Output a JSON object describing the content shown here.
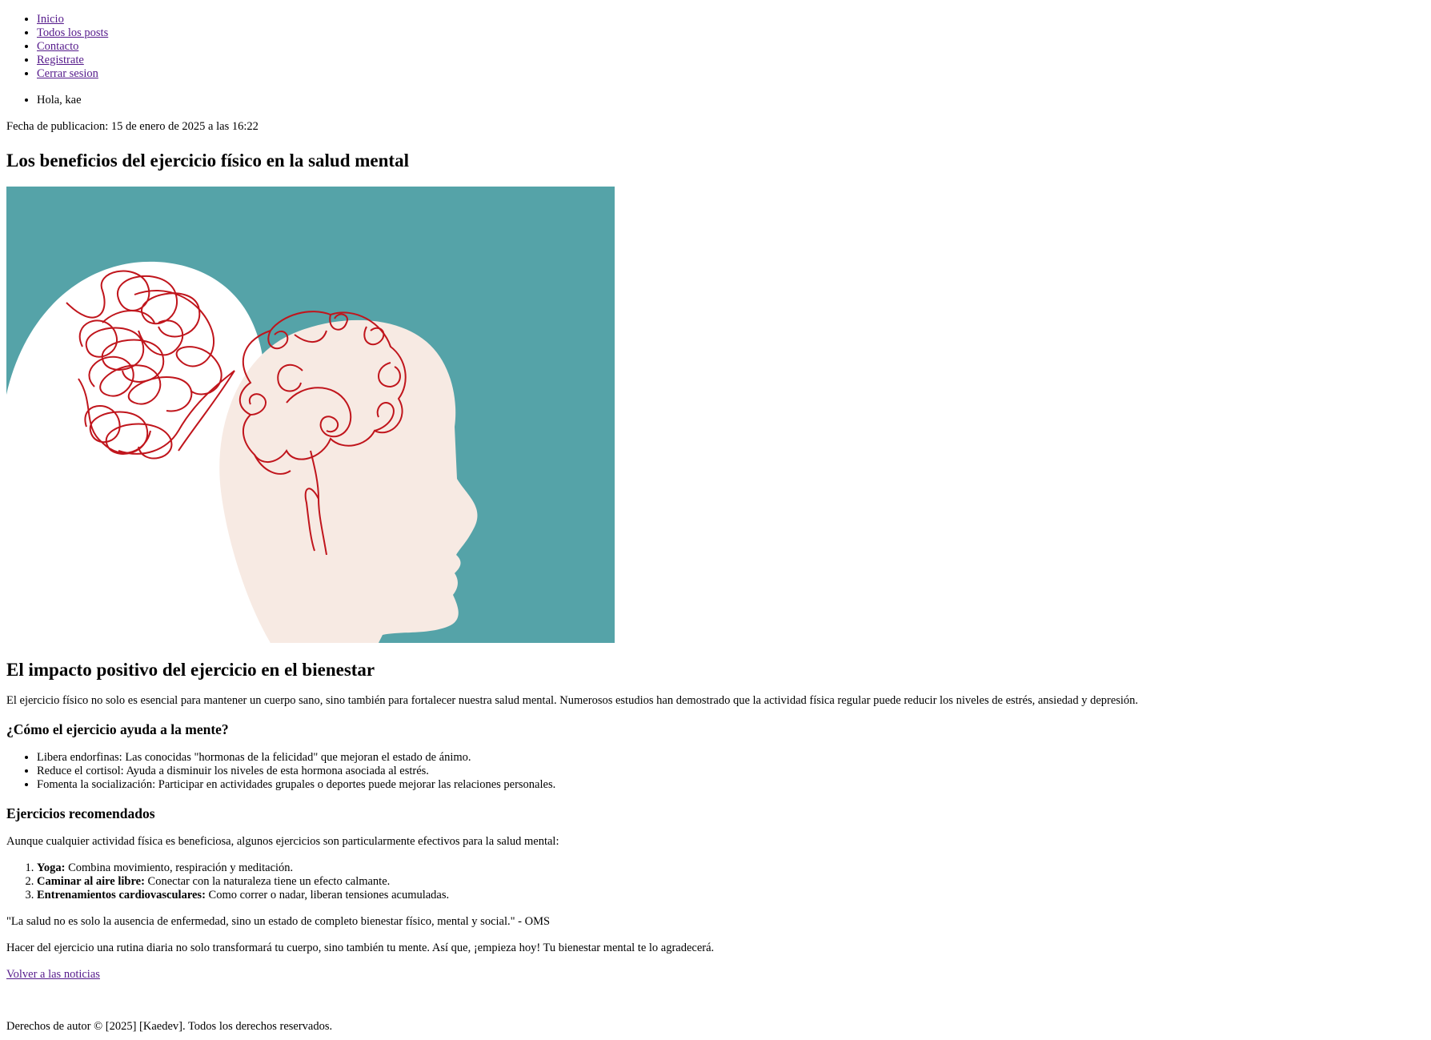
{
  "nav": {
    "items": [
      "Inicio",
      "Todos los posts",
      "Contacto",
      "Registrate",
      "Cerrar sesion"
    ]
  },
  "user": {
    "greeting": "Hola, kae"
  },
  "post": {
    "date": "Fecha de publicacion: 15 de enero de 2025 a las 16:22",
    "title": "Los beneficios del ejercicio físico en la salud mental",
    "image": {
      "description": "",
      "colors": {
        "background": "#55a3a8",
        "head_left": "#ffffff",
        "head_right": "#f7eae3",
        "lines": "#c0151c"
      }
    },
    "section_title": "El impacto positivo del ejercicio en el bienestar",
    "intro": "El ejercicio físico no solo es esencial para mantener un cuerpo sano, sino también para fortalecer nuestra salud mental. Numerosos estudios han demostrado que la actividad física regular puede reducir los niveles de estrés, ansiedad y depresión.",
    "how_title": "¿Cómo el ejercicio ayuda a la mente?",
    "how_items": [
      "Libera endorfinas: Las conocidas \"hormonas de la felicidad\" que mejoran el estado de ánimo.",
      "Reduce el cortisol: Ayuda a disminuir los niveles de esta hormona asociada al estrés.",
      "Fomenta la socialización: Participar en actividades grupales o deportes puede mejorar las relaciones personales."
    ],
    "exercises_title": "Ejercicios recomendados",
    "exercises_intro": "Aunque cualquier actividad física es beneficiosa, algunos ejercicios son particularmente efectivos para la salud mental:",
    "exercises": [
      {
        "name": "Yoga:",
        "text": " Combina movimiento, respiración y meditación."
      },
      {
        "name": "Caminar al aire libre:",
        "text": " Conectar con la naturaleza tiene un efecto calmante."
      },
      {
        "name": "Entrenamientos cardiovasculares:",
        "text": " Como correr o nadar, liberan tensiones acumuladas."
      }
    ],
    "quote": "\"La salud no es solo la ausencia de enfermedad, sino un estado de completo bienestar físico, mental y social.\" - OMS",
    "closing": "Hacer del ejercicio una rutina diaria no solo transformará tu cuerpo, sino también tu mente. Así que, ¡empieza hoy! Tu bienestar mental te lo agradecerá.",
    "back_link": "Volver a las noticias"
  },
  "footer": {
    "text": "Derechos de autor © [2025] [Kaedev]. Todos los derechos reservados."
  }
}
